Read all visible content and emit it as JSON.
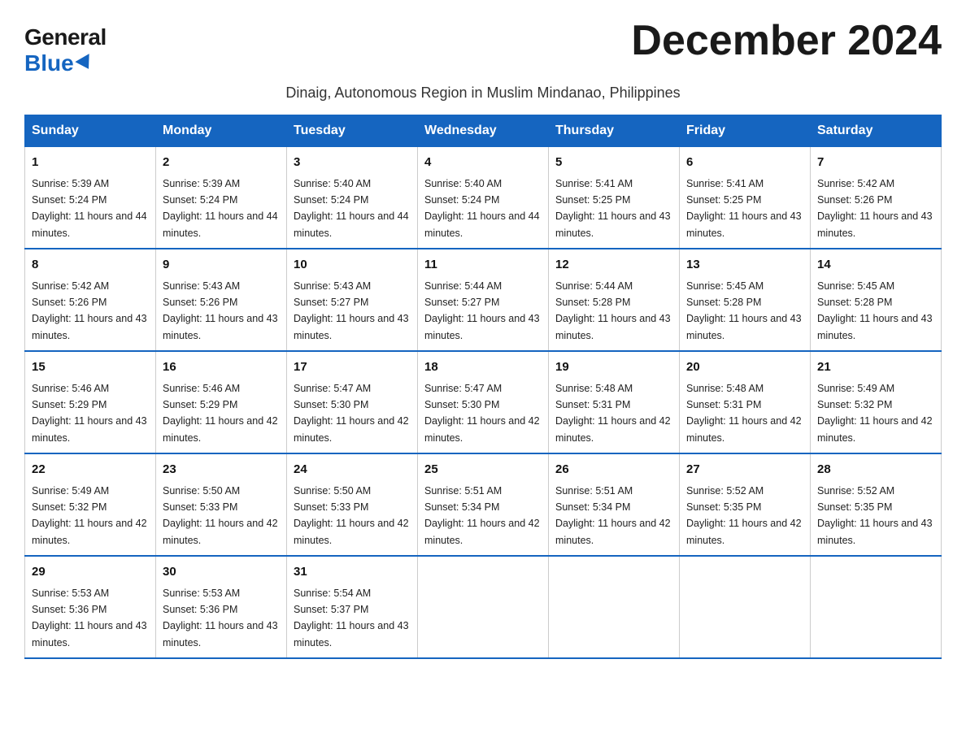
{
  "logo": {
    "general": "General",
    "blue": "Blue"
  },
  "title": "December 2024",
  "subtitle": "Dinaig, Autonomous Region in Muslim Mindanao, Philippines",
  "days_of_week": [
    "Sunday",
    "Monday",
    "Tuesday",
    "Wednesday",
    "Thursday",
    "Friday",
    "Saturday"
  ],
  "weeks": [
    [
      {
        "day": "1",
        "sunrise": "5:39 AM",
        "sunset": "5:24 PM",
        "daylight": "11 hours and 44 minutes."
      },
      {
        "day": "2",
        "sunrise": "5:39 AM",
        "sunset": "5:24 PM",
        "daylight": "11 hours and 44 minutes."
      },
      {
        "day": "3",
        "sunrise": "5:40 AM",
        "sunset": "5:24 PM",
        "daylight": "11 hours and 44 minutes."
      },
      {
        "day": "4",
        "sunrise": "5:40 AM",
        "sunset": "5:24 PM",
        "daylight": "11 hours and 44 minutes."
      },
      {
        "day": "5",
        "sunrise": "5:41 AM",
        "sunset": "5:25 PM",
        "daylight": "11 hours and 43 minutes."
      },
      {
        "day": "6",
        "sunrise": "5:41 AM",
        "sunset": "5:25 PM",
        "daylight": "11 hours and 43 minutes."
      },
      {
        "day": "7",
        "sunrise": "5:42 AM",
        "sunset": "5:26 PM",
        "daylight": "11 hours and 43 minutes."
      }
    ],
    [
      {
        "day": "8",
        "sunrise": "5:42 AM",
        "sunset": "5:26 PM",
        "daylight": "11 hours and 43 minutes."
      },
      {
        "day": "9",
        "sunrise": "5:43 AM",
        "sunset": "5:26 PM",
        "daylight": "11 hours and 43 minutes."
      },
      {
        "day": "10",
        "sunrise": "5:43 AM",
        "sunset": "5:27 PM",
        "daylight": "11 hours and 43 minutes."
      },
      {
        "day": "11",
        "sunrise": "5:44 AM",
        "sunset": "5:27 PM",
        "daylight": "11 hours and 43 minutes."
      },
      {
        "day": "12",
        "sunrise": "5:44 AM",
        "sunset": "5:28 PM",
        "daylight": "11 hours and 43 minutes."
      },
      {
        "day": "13",
        "sunrise": "5:45 AM",
        "sunset": "5:28 PM",
        "daylight": "11 hours and 43 minutes."
      },
      {
        "day": "14",
        "sunrise": "5:45 AM",
        "sunset": "5:28 PM",
        "daylight": "11 hours and 43 minutes."
      }
    ],
    [
      {
        "day": "15",
        "sunrise": "5:46 AM",
        "sunset": "5:29 PM",
        "daylight": "11 hours and 43 minutes."
      },
      {
        "day": "16",
        "sunrise": "5:46 AM",
        "sunset": "5:29 PM",
        "daylight": "11 hours and 42 minutes."
      },
      {
        "day": "17",
        "sunrise": "5:47 AM",
        "sunset": "5:30 PM",
        "daylight": "11 hours and 42 minutes."
      },
      {
        "day": "18",
        "sunrise": "5:47 AM",
        "sunset": "5:30 PM",
        "daylight": "11 hours and 42 minutes."
      },
      {
        "day": "19",
        "sunrise": "5:48 AM",
        "sunset": "5:31 PM",
        "daylight": "11 hours and 42 minutes."
      },
      {
        "day": "20",
        "sunrise": "5:48 AM",
        "sunset": "5:31 PM",
        "daylight": "11 hours and 42 minutes."
      },
      {
        "day": "21",
        "sunrise": "5:49 AM",
        "sunset": "5:32 PM",
        "daylight": "11 hours and 42 minutes."
      }
    ],
    [
      {
        "day": "22",
        "sunrise": "5:49 AM",
        "sunset": "5:32 PM",
        "daylight": "11 hours and 42 minutes."
      },
      {
        "day": "23",
        "sunrise": "5:50 AM",
        "sunset": "5:33 PM",
        "daylight": "11 hours and 42 minutes."
      },
      {
        "day": "24",
        "sunrise": "5:50 AM",
        "sunset": "5:33 PM",
        "daylight": "11 hours and 42 minutes."
      },
      {
        "day": "25",
        "sunrise": "5:51 AM",
        "sunset": "5:34 PM",
        "daylight": "11 hours and 42 minutes."
      },
      {
        "day": "26",
        "sunrise": "5:51 AM",
        "sunset": "5:34 PM",
        "daylight": "11 hours and 42 minutes."
      },
      {
        "day": "27",
        "sunrise": "5:52 AM",
        "sunset": "5:35 PM",
        "daylight": "11 hours and 42 minutes."
      },
      {
        "day": "28",
        "sunrise": "5:52 AM",
        "sunset": "5:35 PM",
        "daylight": "11 hours and 43 minutes."
      }
    ],
    [
      {
        "day": "29",
        "sunrise": "5:53 AM",
        "sunset": "5:36 PM",
        "daylight": "11 hours and 43 minutes."
      },
      {
        "day": "30",
        "sunrise": "5:53 AM",
        "sunset": "5:36 PM",
        "daylight": "11 hours and 43 minutes."
      },
      {
        "day": "31",
        "sunrise": "5:54 AM",
        "sunset": "5:37 PM",
        "daylight": "11 hours and 43 minutes."
      },
      null,
      null,
      null,
      null
    ]
  ],
  "labels": {
    "sunrise": "Sunrise:",
    "sunset": "Sunset:",
    "daylight": "Daylight:"
  }
}
